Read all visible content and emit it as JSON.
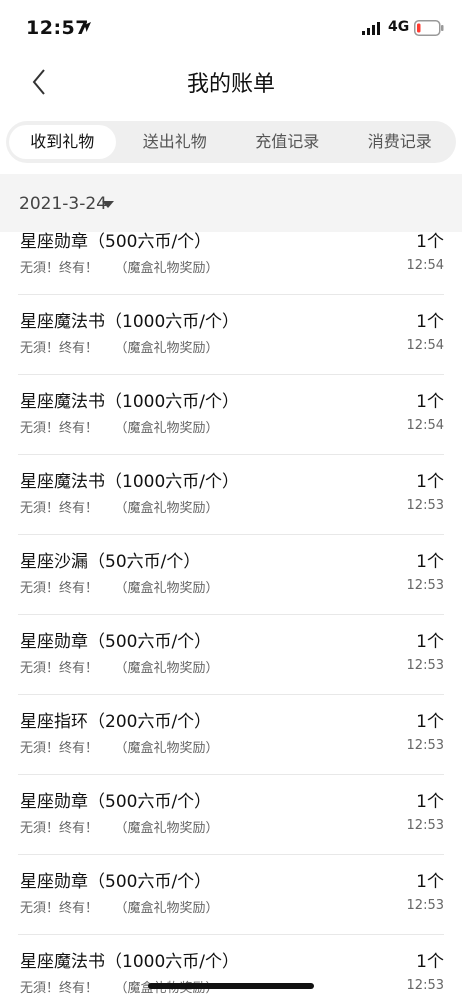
{
  "status_bar": {
    "time": "12:57",
    "network": "4G",
    "battery_color": "#ff3b30"
  },
  "nav": {
    "title": "我的账单",
    "back_icon": "chevron-left-icon"
  },
  "tabs": [
    {
      "label": "收到礼物",
      "active": true
    },
    {
      "label": "送出礼物",
      "active": false
    },
    {
      "label": "充值记录",
      "active": false
    },
    {
      "label": "消费记录",
      "active": false
    }
  ],
  "date_filter": {
    "value": "2021-3-24"
  },
  "records": [
    {
      "title": "星座勋章（500六币/个）",
      "subtitle": "无須！终有！    （魔盒礼物奖励）",
      "quantity": "1个",
      "time": "12:54"
    },
    {
      "title": "星座魔法书（1000六币/个）",
      "subtitle": "无須！终有！    （魔盒礼物奖励）",
      "quantity": "1个",
      "time": "12:54"
    },
    {
      "title": "星座魔法书（1000六币/个）",
      "subtitle": "无須！终有！    （魔盒礼物奖励）",
      "quantity": "1个",
      "time": "12:54"
    },
    {
      "title": "星座魔法书（1000六币/个）",
      "subtitle": "无須！终有！    （魔盒礼物奖励）",
      "quantity": "1个",
      "time": "12:53"
    },
    {
      "title": "星座沙漏（50六币/个）",
      "subtitle": "无須！终有！    （魔盒礼物奖励）",
      "quantity": "1个",
      "time": "12:53"
    },
    {
      "title": "星座勋章（500六币/个）",
      "subtitle": "无須！终有！    （魔盒礼物奖励）",
      "quantity": "1个",
      "time": "12:53"
    },
    {
      "title": "星座指环（200六币/个）",
      "subtitle": "无須！终有！    （魔盒礼物奖励）",
      "quantity": "1个",
      "time": "12:53"
    },
    {
      "title": "星座勋章（500六币/个）",
      "subtitle": "无須！终有！    （魔盒礼物奖励）",
      "quantity": "1个",
      "time": "12:53"
    },
    {
      "title": "星座勋章（500六币/个）",
      "subtitle": "无須！终有！    （魔盒礼物奖励）",
      "quantity": "1个",
      "time": "12:53"
    },
    {
      "title": "星座魔法书（1000六币/个）",
      "subtitle": "无須！终有！    （魔盒礼物奖励）",
      "quantity": "1个",
      "time": "12:53"
    }
  ]
}
